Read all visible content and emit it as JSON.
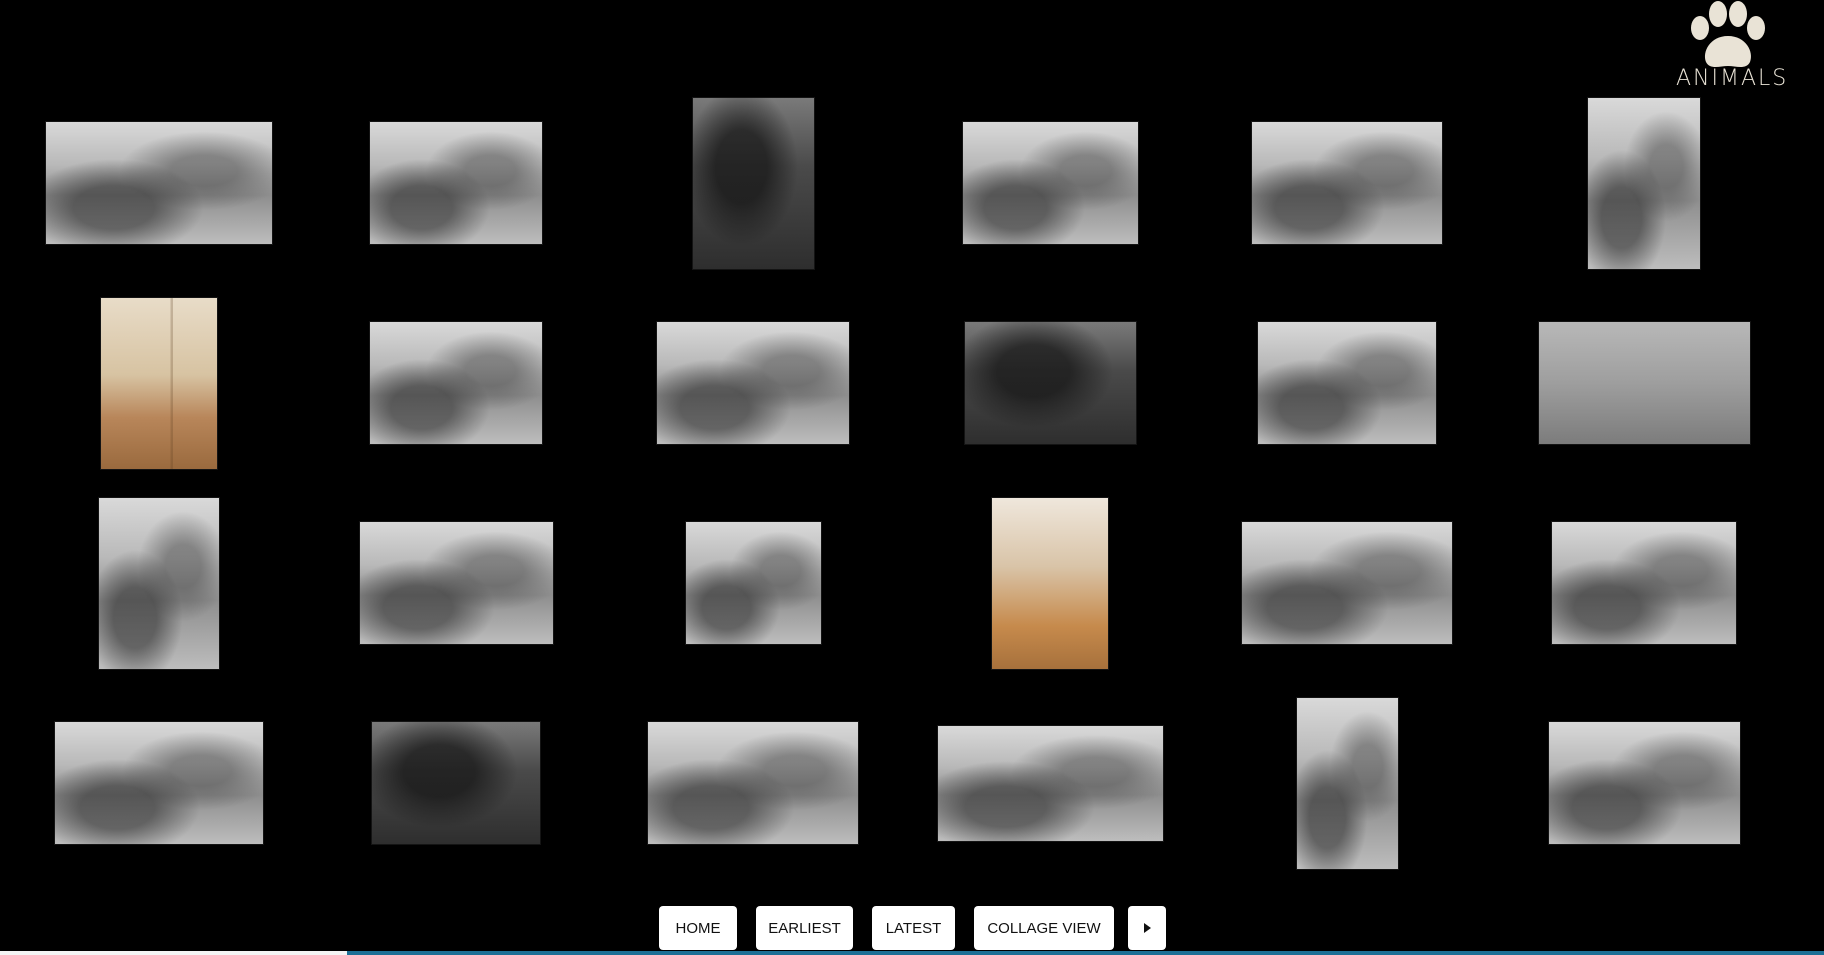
{
  "logo": {
    "text": "ANIMALS",
    "icon": "paw-icon",
    "color": "#e9e3d6"
  },
  "photos": [
    {
      "name": "photo-horse-buggy",
      "tone": "bw"
    },
    {
      "name": "photo-horses-hillside",
      "tone": "bw"
    },
    {
      "name": "photo-man-with-dog",
      "tone": "dark"
    },
    {
      "name": "photo-logging-horses",
      "tone": "bw"
    },
    {
      "name": "photo-truck-group",
      "tone": "bw"
    },
    {
      "name": "photo-man-horse-trees",
      "tone": "bw"
    },
    {
      "name": "photo-boy-house-color",
      "tone": "sepia"
    },
    {
      "name": "photo-plowing-horses",
      "tone": "bw"
    },
    {
      "name": "photo-man-german-shepherd",
      "tone": "bw"
    },
    {
      "name": "photo-dark-field",
      "tone": "dark"
    },
    {
      "name": "photo-rider-white-horse",
      "tone": "bw"
    },
    {
      "name": "photo-man-colt-foggy",
      "tone": "fog"
    },
    {
      "name": "photo-couple-with-dogs",
      "tone": "bw"
    },
    {
      "name": "photo-horse-wagons-road",
      "tone": "bw"
    },
    {
      "name": "photo-riders-street",
      "tone": "bw"
    },
    {
      "name": "photo-woman-dog-stairs",
      "tone": "warm"
    },
    {
      "name": "photo-man-workhorse",
      "tone": "bw"
    },
    {
      "name": "photo-family-group",
      "tone": "bw"
    },
    {
      "name": "photo-woman-horse-signed",
      "tone": "bw"
    },
    {
      "name": "photo-orchard-ladder",
      "tone": "dark"
    },
    {
      "name": "photo-town-wagons",
      "tone": "bw"
    },
    {
      "name": "photo-team-passenger-wagon",
      "tone": "bw"
    },
    {
      "name": "photo-girl-with-cat",
      "tone": "bw"
    },
    {
      "name": "photo-road-crew-wagons",
      "tone": "bw"
    }
  ],
  "nav": {
    "home": "HOME",
    "earliest": "EARLIEST",
    "latest": "LATEST",
    "collage_view": "COLLAGE VIEW",
    "next_icon": "play-right-icon"
  },
  "progress": {
    "fraction": 0.19
  }
}
